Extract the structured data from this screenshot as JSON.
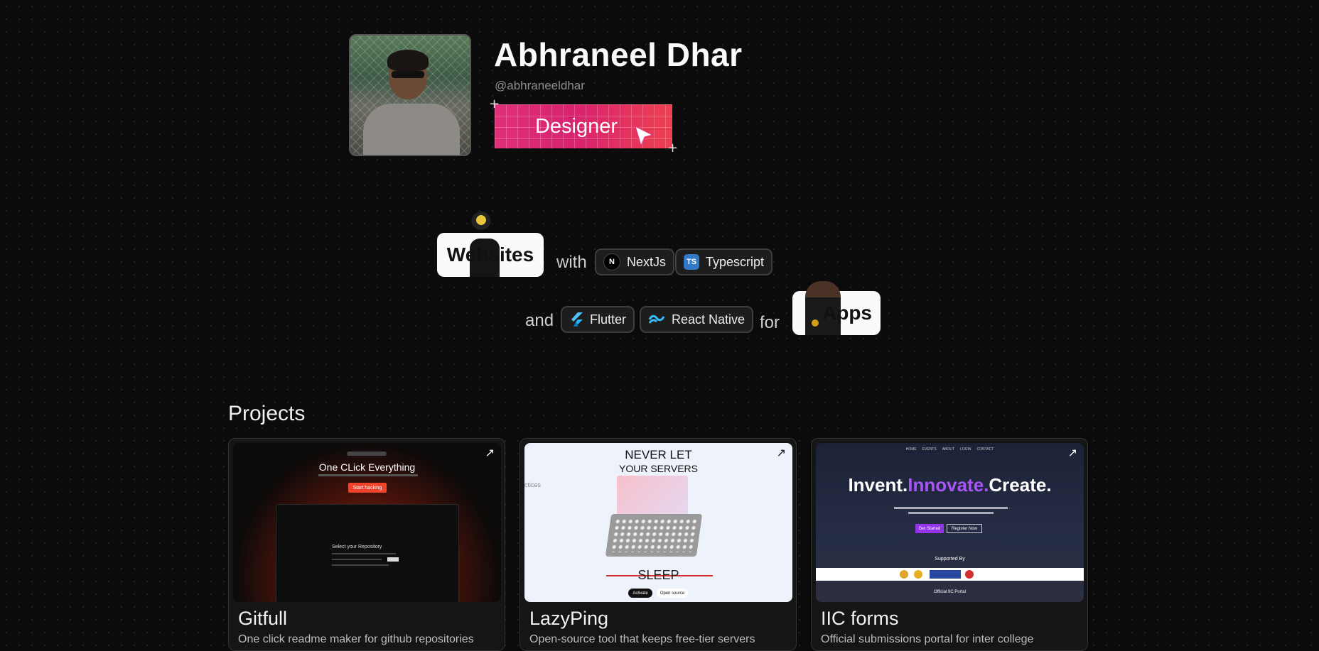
{
  "profile": {
    "name": "Abhraneel Dhar",
    "handle": "@abhraneeldhar",
    "role_badge": "Designer"
  },
  "skills": {
    "websites_label": "Websites",
    "with_word": "with",
    "and_word": "and",
    "for_word": "for",
    "apps_label": "Apps",
    "tech_row1": [
      {
        "label": "NextJs",
        "icon": "nextjs-icon",
        "icon_text": "N"
      },
      {
        "label": "Typescript",
        "icon": "typescript-icon",
        "icon_text": "TS"
      }
    ],
    "tech_row2": [
      {
        "label": "Flutter",
        "icon": "flutter-icon"
      },
      {
        "label": "React Native",
        "icon": "tailwind-wave-icon"
      }
    ]
  },
  "projects": {
    "heading": "Projects",
    "items": [
      {
        "title": "Gitfull",
        "description": "One click readme maker for github repositories",
        "preview": {
          "headline": "One CLick Everything",
          "button": "Start hacking",
          "panel_title": "Select your Repository"
        }
      },
      {
        "title": "LazyPing",
        "description": "Open-source tool that keeps free-tier servers",
        "preview": {
          "headline_line1": "NEVER LET",
          "headline_line2": "YOUR SERVERS",
          "footer_word": "SLEEP",
          "side_text": "ctices",
          "btn_primary": "Activate",
          "btn_secondary": "Open source"
        }
      },
      {
        "title": "IIC forms",
        "description": "Official submissions portal for inter college",
        "preview": {
          "word1": "Invent.",
          "word2": "Innovate.",
          "word3": "Create.",
          "nav": [
            "HOME",
            "EVENTS",
            "ABOUT",
            "LOGIN",
            "CONTACT"
          ],
          "supported_by": "Supported By",
          "official": "Official IIC Portal",
          "btn_primary": "Get Started",
          "btn_secondary": "Register Now"
        }
      }
    ]
  },
  "colors": {
    "badge_pink": "#e0307a",
    "badge_red": "#ef4050",
    "innovate_purple": "#a855f7",
    "gitfull_orange": "#f0432b"
  }
}
